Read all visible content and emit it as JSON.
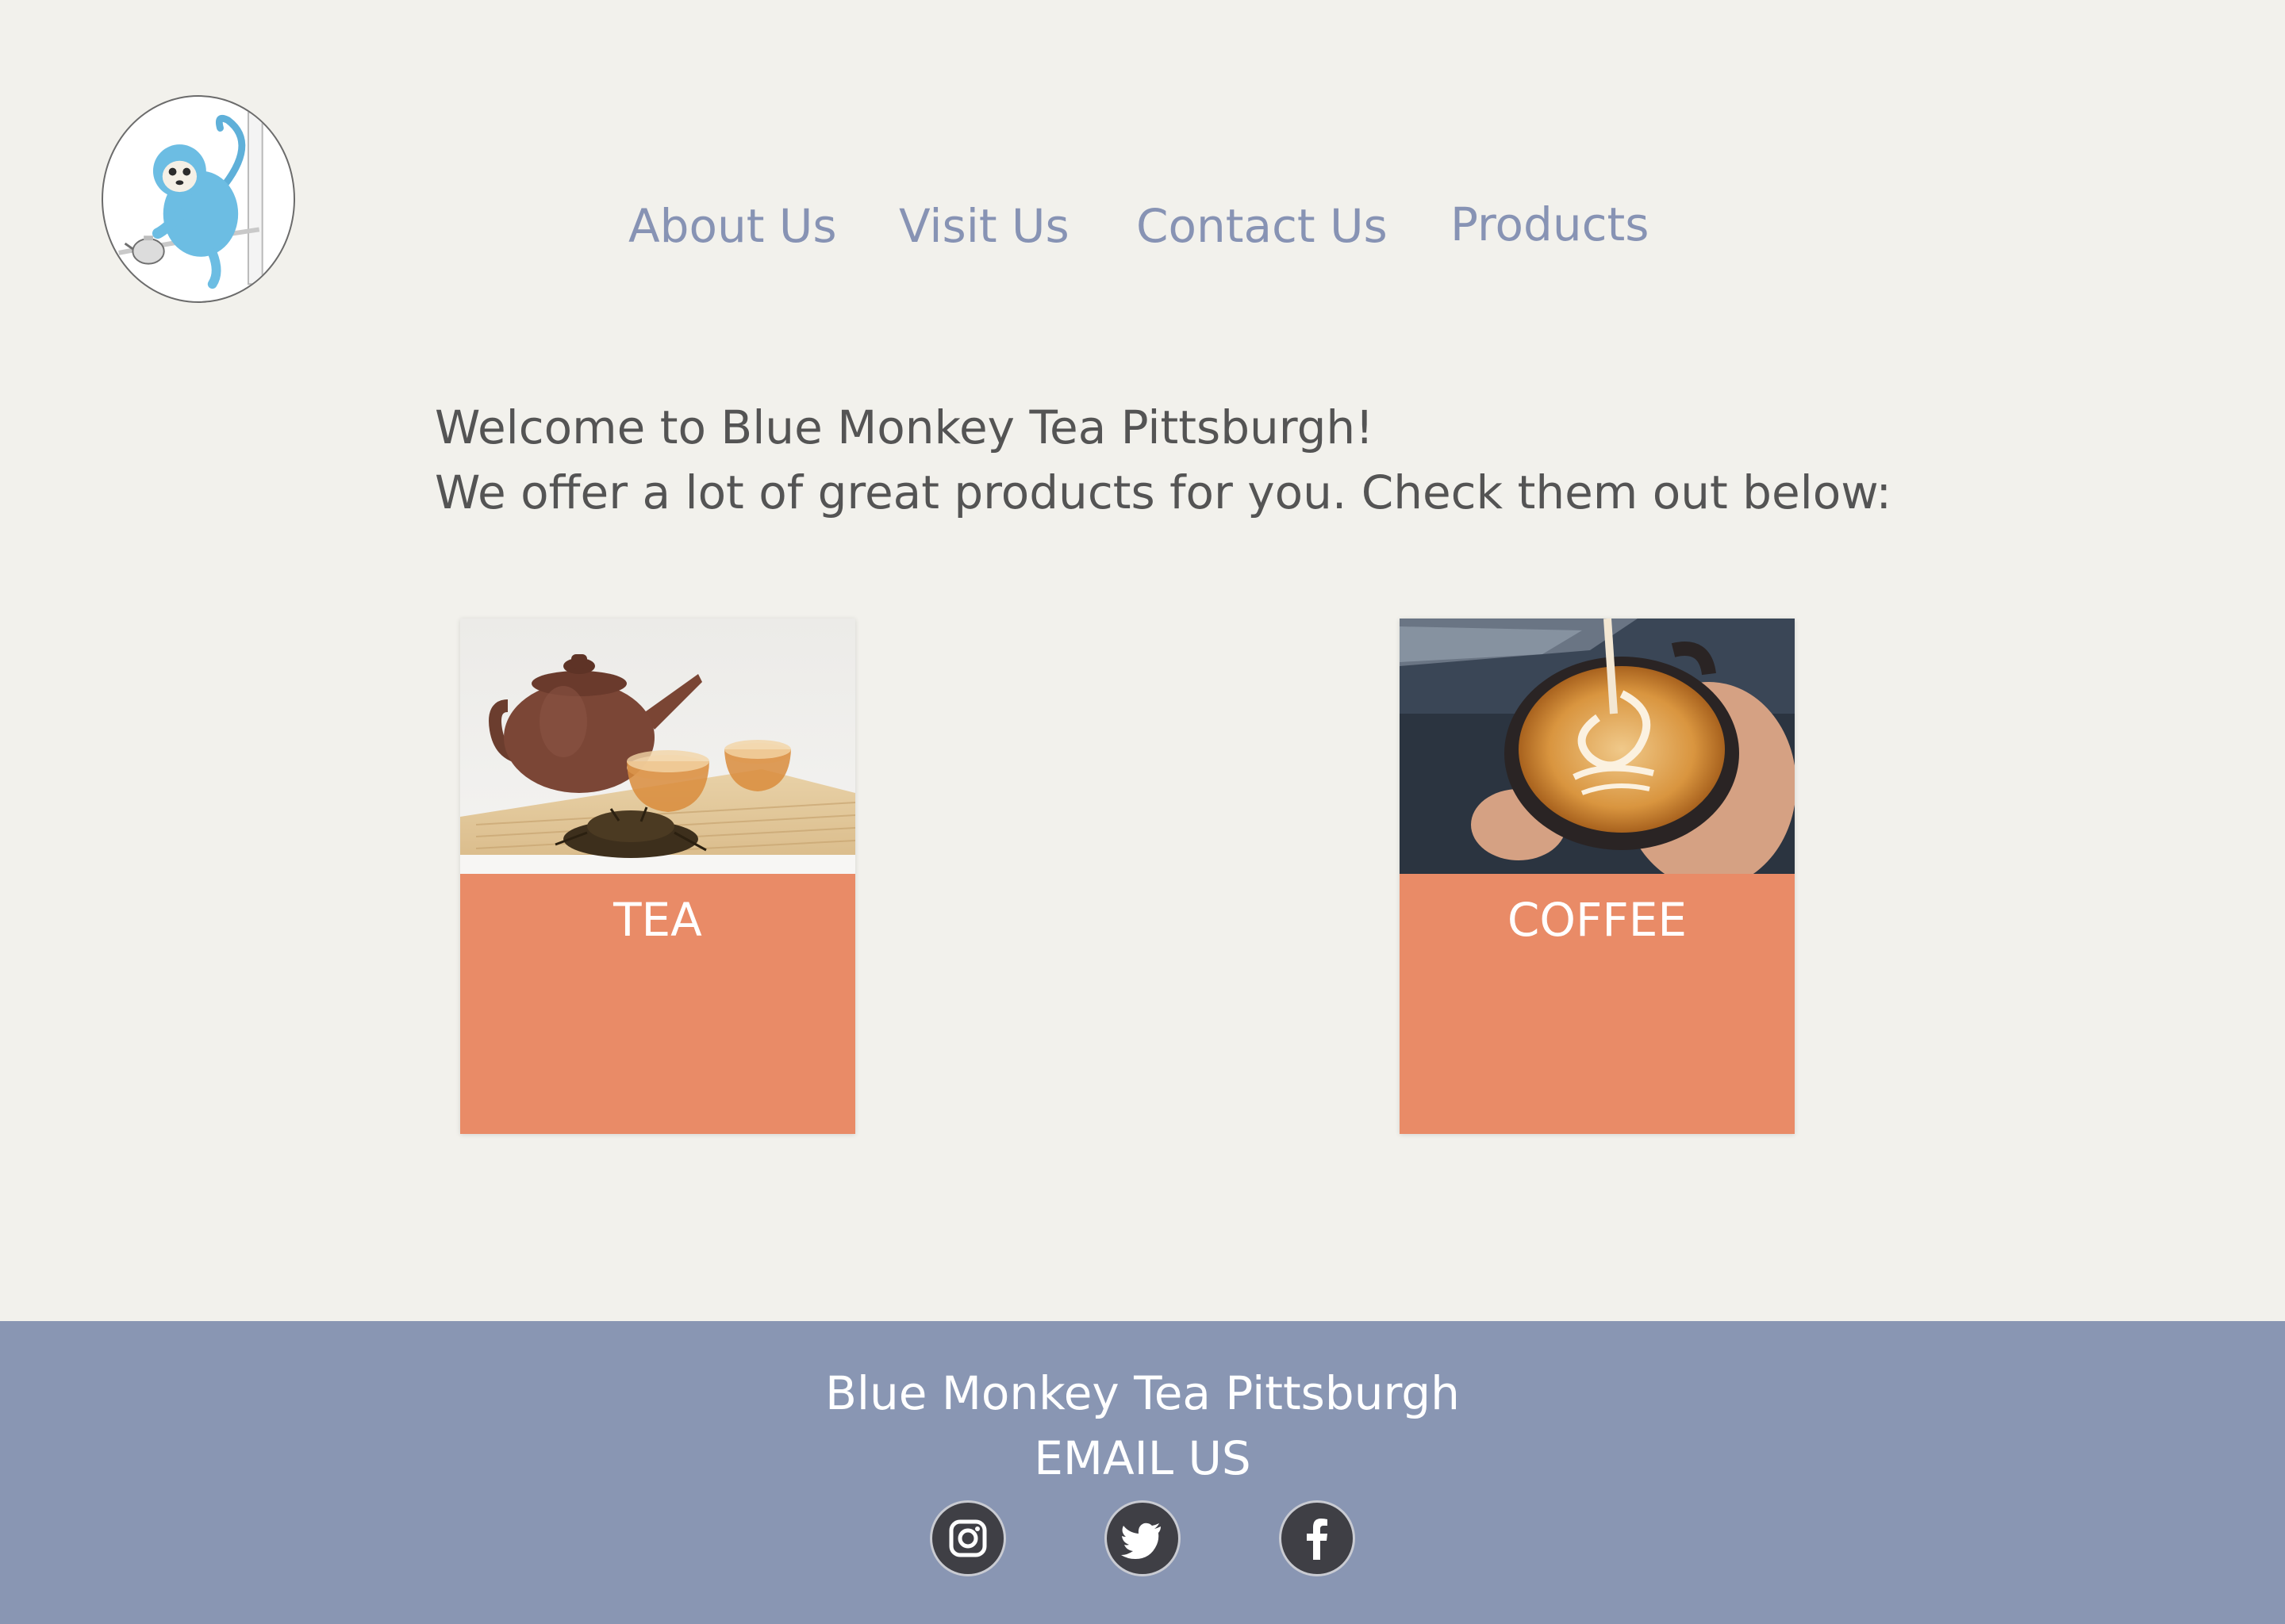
{
  "header": {
    "logo_icon": "blue-monkey-teapot-logo",
    "nav": {
      "about": "About Us",
      "visit": "Visit Us",
      "contact": "Contact Us",
      "products": "Products"
    }
  },
  "welcome": {
    "line1": "Welcome to Blue Monkey Tea Pittsburgh!",
    "line2": "We offer a lot of great products for you. Check them out below:"
  },
  "products": [
    {
      "label": "TEA",
      "image_icon": "teapot-and-tea-cups-photo"
    },
    {
      "label": "COFFEE",
      "image_icon": "latte-art-cup-photo"
    }
  ],
  "footer": {
    "title": "Blue Monkey Tea Pittsburgh",
    "email": "EMAIL US",
    "social": [
      "instagram-icon",
      "twitter-icon",
      "facebook-icon"
    ]
  },
  "colors": {
    "background": "#f2f1ec",
    "nav_text": "#8793b4",
    "body_text": "#545454",
    "card": "#e98b67",
    "footer": "#8996b3",
    "social_icon": "#3f3f45"
  }
}
